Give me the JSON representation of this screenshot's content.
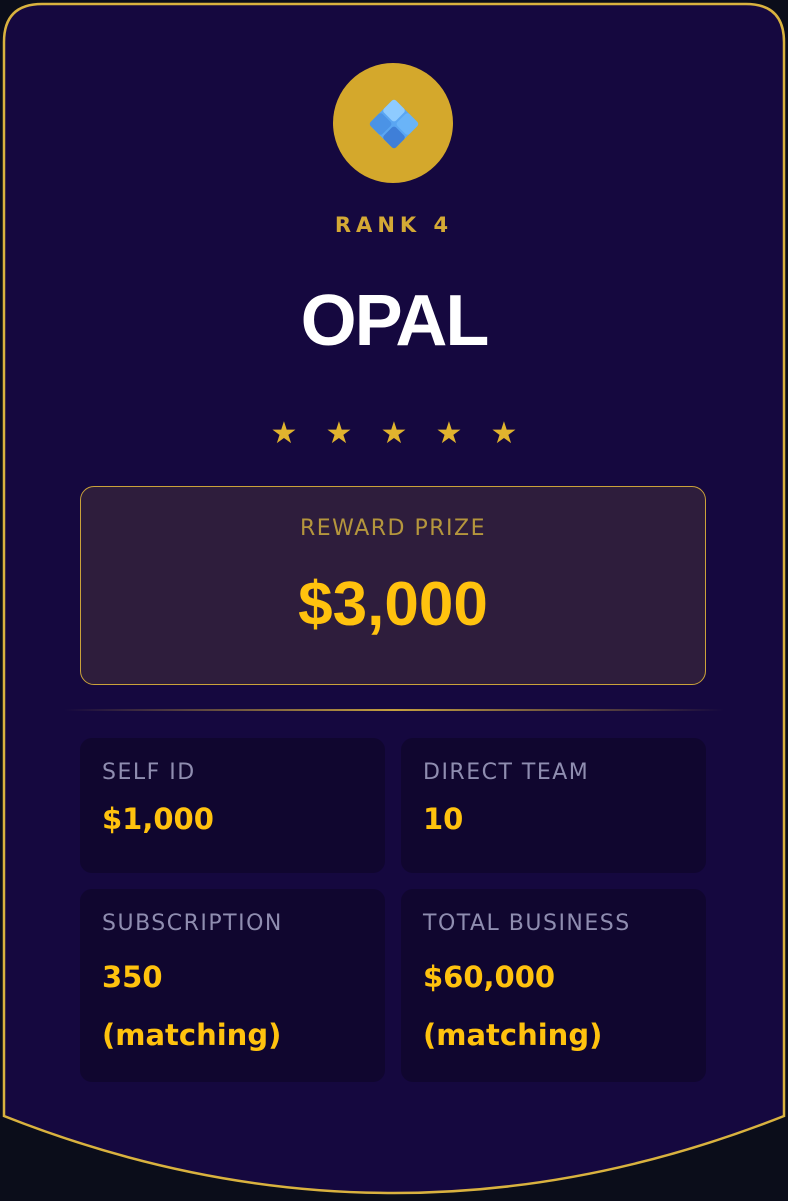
{
  "rank": {
    "label": "RANK 4",
    "title": "OPAL",
    "stars": [
      "★",
      "★",
      "★",
      "★",
      "★"
    ],
    "star_count": 5,
    "emblem_icon": "diamond-gem-icon"
  },
  "reward": {
    "label": "REWARD PRIZE",
    "value": "$3,000"
  },
  "stats": {
    "self_id": {
      "label": "SELF ID",
      "value": "$1,000"
    },
    "direct_team": {
      "label": "DIRECT TEAM",
      "value": "10"
    },
    "subscription": {
      "label": "SUBSCRIPTION",
      "value_line1": "350",
      "value_line2": "(matching)"
    },
    "total_business": {
      "label": "TOTAL BUSINESS",
      "value_line1": "$60,000",
      "value_line2": "(matching)"
    }
  },
  "colors": {
    "card_background": "#15083f",
    "card_border": "#d9b23f",
    "accent_gold": "#ffc20e",
    "emblem_background": "#d4a82c",
    "stat_tile_background": "#10062f",
    "prize_box_background": "#2e1d3c",
    "label_muted": "#8f8db0"
  }
}
